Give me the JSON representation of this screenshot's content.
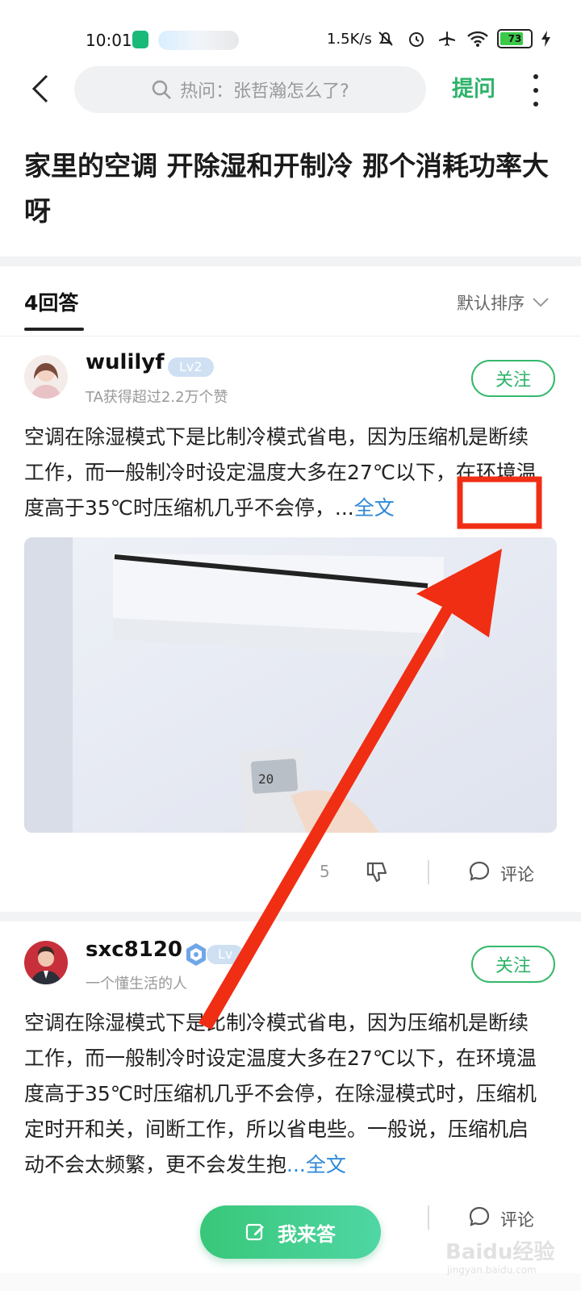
{
  "status_bar": {
    "time": "10:01",
    "speed": "1.5K/s",
    "battery": "73"
  },
  "nav": {
    "search_placeholder": "热问：张哲瀚怎么了?",
    "ask_label": "提问"
  },
  "question": {
    "title": "家里的空调 开除湿和开制冷 那个消耗功率大呀"
  },
  "answers_header": {
    "count_label": "4回答",
    "sort_label": "默认排序"
  },
  "answers": [
    {
      "username": "wulilyf",
      "level": "Lv2",
      "subtitle": "TA获得超过2.2万个赞",
      "follow_label": "关注",
      "text": "空调在除湿模式下是比制冷模式省电，因为压缩机是断续工作，而一般制冷时设定温度大多在27℃以下，在环境温度高于35℃时压缩机几乎不会停，",
      "ellipsis": "...",
      "full_text_label": "全文",
      "likes": "5",
      "comment_label": "评论",
      "remote_display": "20"
    },
    {
      "username": "sxc8120",
      "level": "Lv",
      "subtitle": "一个懂生活的人",
      "follow_label": "关注",
      "text": "空调在除湿模式下是比制冷模式省电，因为压缩机是断续工作，而一般制冷时设定温度大多在27℃以下，在环境温度高于35℃时压缩机几乎不会停，在除湿模式时，压缩机定时开和关，间断工作，所以省电些。一般说，压缩机启动不会太频繁，更不会发生抱",
      "ellipsis": "...",
      "full_text_label": "全文",
      "comment_label": "评论"
    }
  ],
  "fab": {
    "label": "我来答"
  },
  "watermark": {
    "text": "Baidu经验",
    "url": "jingyan.baidu.com"
  },
  "colors": {
    "accent_green": "#2fb36a",
    "link_blue": "#2f88d8",
    "annotation_red": "#f02e14"
  }
}
